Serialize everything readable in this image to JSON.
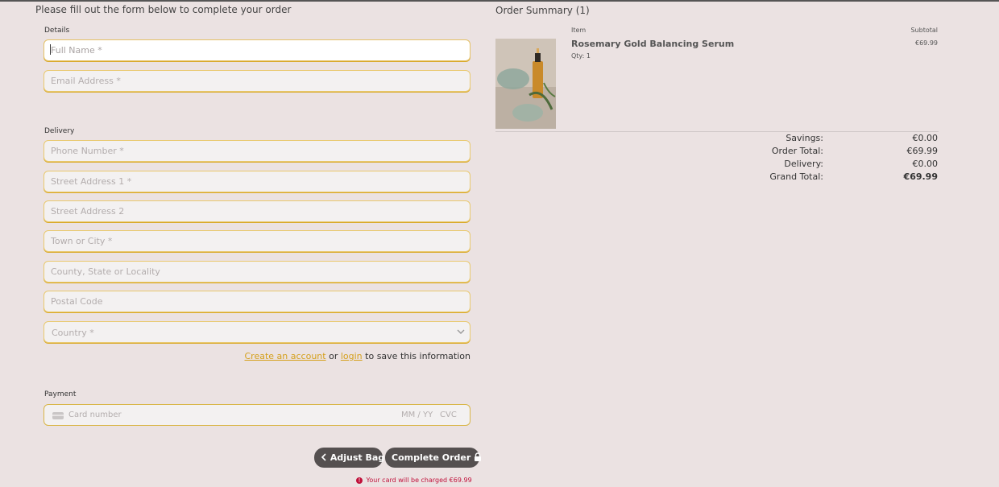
{
  "form": {
    "intro": "Please fill out the form below to complete your order",
    "details_label": "Details",
    "full_name_placeholder": "Full Name *",
    "email_placeholder": "Email Address *",
    "delivery_label": "Delivery",
    "phone_placeholder": "Phone Number *",
    "street1_placeholder": "Street Address 1 *",
    "street2_placeholder": "Street Address 2",
    "town_placeholder": "Town or City *",
    "county_placeholder": "County, State or Locality",
    "postcode_placeholder": "Postal Code",
    "country_selected": "Country *",
    "create_account_link": "Create an account",
    "or_text": "or",
    "login_link": "login",
    "save_info_text": "to save this information",
    "payment_label": "Payment",
    "card_number_placeholder": "Card number",
    "card_expiry_placeholder": "MM / YY",
    "card_cvc_placeholder": "CVC"
  },
  "actions": {
    "adjust_bag": "Adjust Bag",
    "complete_order": "Complete Order",
    "charge_notice": "Your card will be charged €69.99"
  },
  "summary": {
    "title": "Order Summary (1)",
    "col_item": "Item",
    "col_subtotal": "Subtotal",
    "items": [
      {
        "name": "Rosemary Gold Balancing Serum",
        "qty": "Qty: 1",
        "subtotal": "€69.99"
      }
    ],
    "totals": {
      "savings_label": "Savings:",
      "savings": "€0.00",
      "order_total_label": "Order Total:",
      "order_total": "€69.99",
      "delivery_label": "Delivery:",
      "delivery": "€0.00",
      "grand_total_label": "Grand Total:",
      "grand_total": "€69.99"
    }
  },
  "colors": {
    "background": "#ebe2e2",
    "accent_gold": "#d5a01c",
    "button": "#555050",
    "error": "#c0103a"
  }
}
